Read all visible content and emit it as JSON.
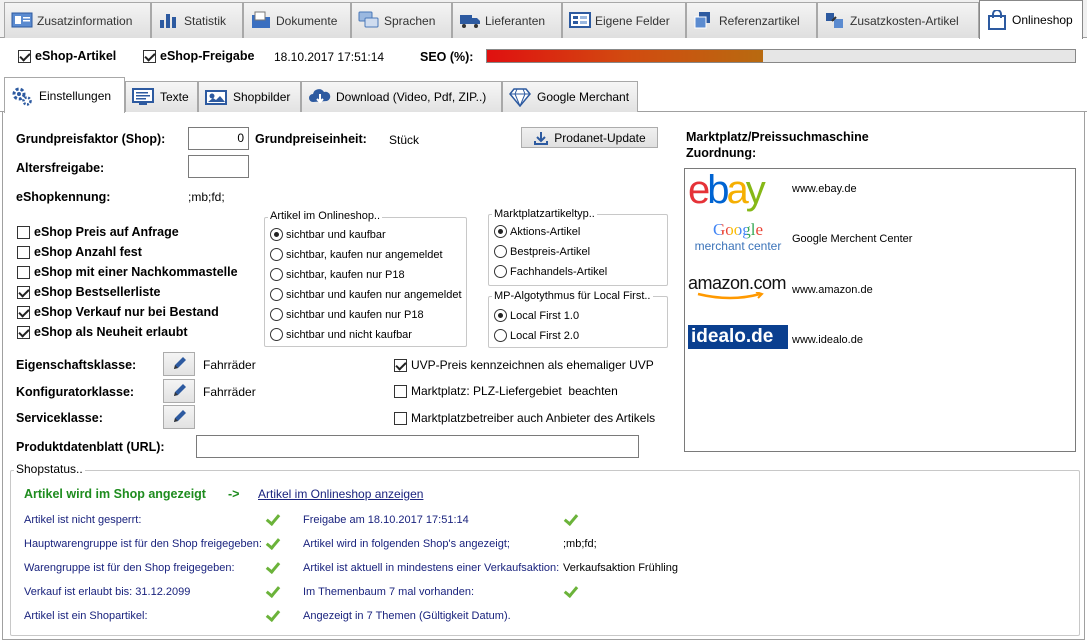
{
  "top_tabs": [
    {
      "label": "Zusatzinformation",
      "icon": "info-card-icon"
    },
    {
      "label": "Statistik",
      "icon": "bar-chart-icon"
    },
    {
      "label": "Dokumente",
      "icon": "documents-icon"
    },
    {
      "label": "Sprachen",
      "icon": "speech-bubbles-icon"
    },
    {
      "label": "Lieferanten",
      "icon": "truck-icon"
    },
    {
      "label": "Eigene Felder",
      "icon": "form-fields-icon"
    },
    {
      "label": "Referenzartikel",
      "icon": "reference-icon"
    },
    {
      "label": "Zusatzkosten-Artikel",
      "icon": "extra-cost-icon"
    },
    {
      "label": "Onlineshop",
      "icon": "shopping-bag-icon"
    }
  ],
  "header": {
    "eshop_artikel": "eShop-Artikel",
    "eshop_freigabe": "eShop-Freigabe",
    "freigabe_date": "18.10.2017 17:51:14",
    "seo_label": "SEO (%):",
    "seo_progress": 0.47
  },
  "sub_tabs": [
    {
      "label": "Einstellungen",
      "icon": "gears-icon"
    },
    {
      "label": "Texte",
      "icon": "monitor-text-icon"
    },
    {
      "label": "Shopbilder",
      "icon": "pictures-icon"
    },
    {
      "label": "Download (Video, Pdf, ZIP..)",
      "icon": "cloud-download-icon"
    },
    {
      "label": "Google Merchant",
      "icon": "diamond-icon"
    }
  ],
  "settings": {
    "grundpreisfaktor_label": "Grundpreisfaktor (Shop):",
    "grundpreisfaktor_value": "0",
    "grundpreiseinheit_label": "Grundpreiseinheit:",
    "grundpreiseinheit_value": "Stück",
    "prodanet_button": "Prodanet-Update",
    "altersfreigabe_label": "Altersfreigabe:",
    "altersfreigabe_value": "",
    "eshopkennung_label": "eShopkennung:",
    "eshopkennung_value": ";mb;fd;",
    "checkboxes": [
      {
        "label": "eShop Preis auf Anfrage",
        "checked": false
      },
      {
        "label": "eShop Anzahl fest",
        "checked": false
      },
      {
        "label": "eShop mit einer Nachkommastelle",
        "checked": false
      },
      {
        "label": "eShop Bestsellerliste",
        "checked": true
      },
      {
        "label": "eShop Verkauf nur bei Bestand",
        "checked": true
      },
      {
        "label": "eShop als Neuheit erlaubt",
        "checked": true
      }
    ],
    "artikel_group": {
      "title": "Artikel im Onlineshop..",
      "options": [
        {
          "label": "sichtbar und kaufbar",
          "selected": true
        },
        {
          "label": "sichtbar, kaufen nur angemeldet",
          "selected": false
        },
        {
          "label": "sichtbar, kaufen nur P18",
          "selected": false
        },
        {
          "label": "sichtbar und kaufen nur angemeldet",
          "selected": false
        },
        {
          "label": "sichtbar und kaufen nur P18",
          "selected": false
        },
        {
          "label": "sichtbar und nicht kaufbar",
          "selected": false
        }
      ]
    },
    "mp_group": {
      "title": "Marktplatzartikeltyp..",
      "options": [
        {
          "label": "Aktions-Artikel",
          "selected": true
        },
        {
          "label": "Bestpreis-Artikel",
          "selected": false
        },
        {
          "label": "Fachhandels-Artikel",
          "selected": false
        }
      ]
    },
    "algo_group": {
      "title": "MP-Algotythmus für Local First..",
      "options": [
        {
          "label": "Local First 1.0",
          "selected": true
        },
        {
          "label": "Local First 2.0",
          "selected": false
        }
      ]
    },
    "eigenschaftsklasse_label": "Eigenschaftsklasse:",
    "eigenschaftsklasse_value": "Fahrräder",
    "konfiguratorklasse_label": "Konfiguratorklasse:",
    "konfiguratorklasse_value": "Fahrräder",
    "serviceklasse_label": "Serviceklasse:",
    "right_checks": [
      {
        "label": "UVP-Preis kennzeichnen als ehemaliger UVP",
        "checked": true
      },
      {
        "label": "Marktplatz: PLZ-Liefergebiet  beachten",
        "checked": false
      },
      {
        "label": "Marktplatzbetreiber auch Anbieter des Artikels",
        "checked": false
      }
    ],
    "produktdatenblatt_label": "Produktdatenblatt (URL):",
    "produktdatenblatt_value": ""
  },
  "marketplace": {
    "title_line1": "Marktplatz/Preissuchmaschine",
    "title_line2": "Zuordnung:",
    "items": [
      {
        "logo": "ebay",
        "label": "www.ebay.de"
      },
      {
        "logo_line1": "Google",
        "logo_line2": "merchant center",
        "label": "Google Merchent Center"
      },
      {
        "logo": "amazon.com",
        "label": "www.amazon.de"
      },
      {
        "logo": "idealo.de",
        "label": "www.idealo.de"
      }
    ],
    "colors": {
      "ebay_e": "#e53238",
      "ebay_b": "#0064d2",
      "ebay_a": "#f5af02",
      "ebay_y": "#86b817"
    }
  },
  "shopstatus": {
    "title": "Shopstatus..",
    "headline": "Artikel wird im Shop angezeigt",
    "arrow": "->",
    "link": "Artikel im Onlineshop anzeigen",
    "left": [
      {
        "label": "Artikel ist nicht gesperrt:",
        "ok": true
      },
      {
        "label": "Hauptwarengruppe ist für den Shop freigegeben:",
        "ok": true
      },
      {
        "label": "Warengruppe ist für den Shop freigegeben:",
        "ok": true
      },
      {
        "label": "Verkauf ist erlaubt bis: 31.12.2099",
        "ok": true
      },
      {
        "label": "Artikel ist ein Shopartikel:",
        "ok": true
      }
    ],
    "right": [
      {
        "label": "Freigabe am 18.10.2017 17:51:14",
        "value": "",
        "ok": true
      },
      {
        "label": "Artikel wird in folgenden Shop's angezeigt;",
        "value": ";mb;fd;",
        "ok": false
      },
      {
        "label": "Artikel ist aktuell in mindestens einer Verkaufsaktion:",
        "value": "Verkaufsaktion Frühling",
        "ok": false
      },
      {
        "label": "Im Themenbaum 7 mal vorhanden:",
        "value": "",
        "ok": true
      },
      {
        "label": "Angezeigt in 7 Themen (Gültigkeit Datum).",
        "value": "",
        "ok": false
      }
    ]
  }
}
